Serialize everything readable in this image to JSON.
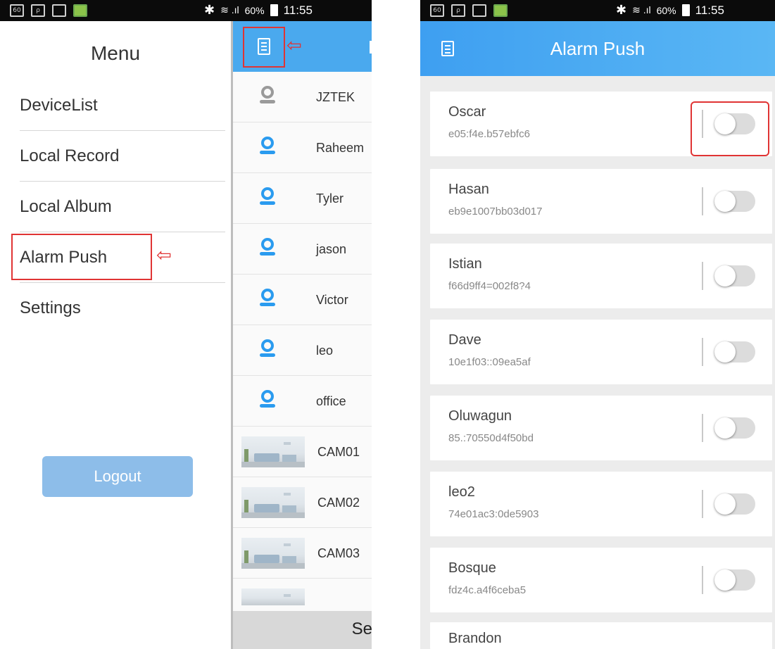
{
  "status_bar": {
    "left_icons": [
      "60-icon",
      "search-app-icon",
      "gallery-icon",
      "game-app-icon"
    ],
    "left_icon_texts": [
      "60",
      "ρ",
      "",
      ""
    ],
    "bluetooth": "✱",
    "signal": "≋ .ıl",
    "battery_pct": "60%",
    "time": "11:55"
  },
  "left": {
    "menu": {
      "title": "Menu",
      "items": [
        {
          "label": "DeviceList"
        },
        {
          "label": "Local Record"
        },
        {
          "label": "Local Album"
        },
        {
          "label": "Alarm Push"
        },
        {
          "label": "Settings"
        }
      ],
      "arrow": "⇦",
      "logout_label": "Logout"
    },
    "device_list": {
      "arrow": "⇦",
      "devices": [
        {
          "name": "JZTEK",
          "online": false
        },
        {
          "name": "Raheem",
          "online": true
        },
        {
          "name": "Tyler",
          "online": true
        },
        {
          "name": "jason",
          "online": true
        },
        {
          "name": "Victor",
          "online": true
        },
        {
          "name": "leo",
          "online": true
        },
        {
          "name": "office",
          "online": true
        }
      ],
      "cameras": [
        {
          "name": "CAM01"
        },
        {
          "name": "CAM02"
        },
        {
          "name": "CAM03"
        }
      ],
      "footer_text": "Se"
    }
  },
  "right": {
    "title": "Alarm Push",
    "alarms": [
      {
        "name": "Oscar",
        "id": "e05:f4e.b57ebfc6",
        "enabled": false
      },
      {
        "name": "Hasan",
        "id": "eb9e1007bb03d017",
        "enabled": false
      },
      {
        "name": "Istian",
        "id": "f66d9ff4=002f8?4",
        "enabled": false
      },
      {
        "name": "Dave",
        "id": "10e1f03::09ea5af",
        "enabled": false
      },
      {
        "name": "Oluwagun",
        "id": "85.:70550d4f50bd",
        "enabled": false
      },
      {
        "name": "leo2",
        "id": "74e01ac3:0de5903",
        "enabled": false
      },
      {
        "name": "Bosque",
        "id": "fdz4c.a4f6ceba5",
        "enabled": false
      },
      {
        "name": "Brandon",
        "id": "",
        "enabled": false
      }
    ]
  }
}
